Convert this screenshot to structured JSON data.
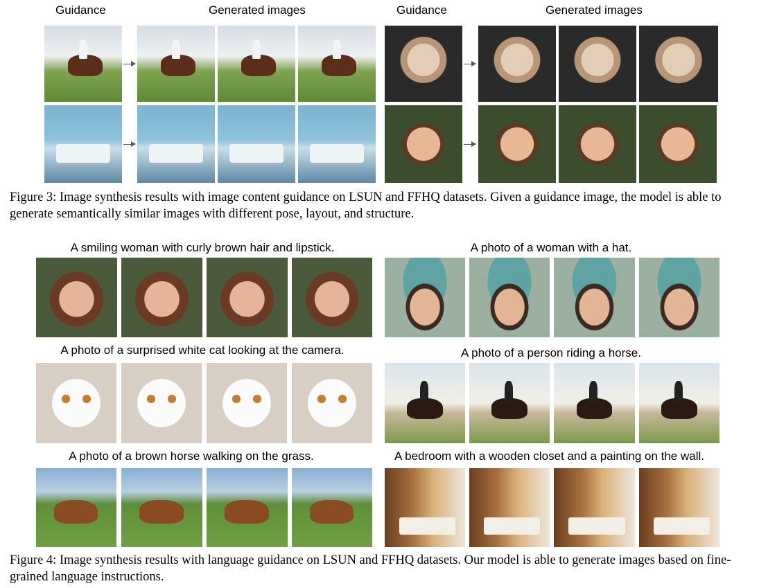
{
  "figure3": {
    "left_headers": {
      "guidance": "Guidance",
      "generated": "Generated images"
    },
    "right_headers": {
      "guidance": "Guidance",
      "generated": "Generated images"
    },
    "caption": "Figure 3: Image synthesis results with image content guidance on LSUN and FFHQ datasets. Given a guidance image, the model is able to generate semantically similar images with different pose, layout, and structure."
  },
  "figure4": {
    "prompts": {
      "woman_curly": "A smiling woman with curly brown hair and lipstick.",
      "woman_hat": "A photo of a woman with a hat.",
      "white_cat": "A photo of a surprised white cat looking at the camera.",
      "person_horse": "A photo of a person riding a horse.",
      "brown_horse": "A photo of a brown horse walking on the grass.",
      "bedroom": "A bedroom with a wooden closet and a painting on the wall."
    },
    "caption": "Figure 4: Image synthesis results with language guidance on LSUN and FFHQ datasets. Our model is able to generate images based on fine-grained language instructions."
  }
}
